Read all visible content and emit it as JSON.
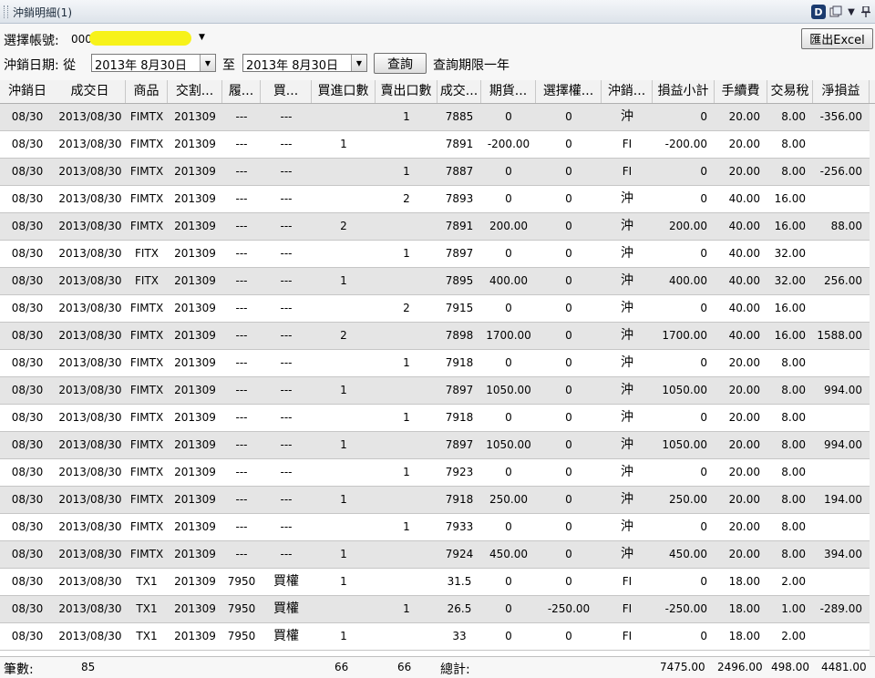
{
  "window": {
    "title": "沖銷明細(1)",
    "d_icon_letter": "D"
  },
  "toolbar": {
    "account_label": "選擇帳號:",
    "account_value": "000",
    "date_label": "沖銷日期: 從",
    "date_from": "2013年  8月30日",
    "to_label": "至",
    "date_to": "2013年  8月30日",
    "query_button": "查詢",
    "query_note": "查詢期限一年",
    "excel_button": "匯出Excel"
  },
  "table": {
    "columns": [
      "沖銷日",
      "成交日",
      "商品",
      "交割...",
      "履...",
      "買...",
      "買進口數",
      "賣出口數",
      "成交...",
      "期貨...",
      "選擇權...",
      "沖銷...",
      "損益小計",
      "手續費",
      "交易稅",
      "淨損益"
    ],
    "rows": [
      [
        "08/30",
        "2013/08/30",
        "FIMTX",
        "201309",
        "---",
        "---",
        "",
        "1",
        "7885",
        "0",
        "0",
        "沖",
        "0",
        "20.00",
        "8.00",
        "-356.00"
      ],
      [
        "08/30",
        "2013/08/30",
        "FIMTX",
        "201309",
        "---",
        "---",
        "1",
        "",
        "7891",
        "-200.00",
        "0",
        "FI",
        "-200.00",
        "20.00",
        "8.00",
        ""
      ],
      [
        "08/30",
        "2013/08/30",
        "FIMTX",
        "201309",
        "---",
        "---",
        "",
        "1",
        "7887",
        "0",
        "0",
        "FI",
        "0",
        "20.00",
        "8.00",
        "-256.00"
      ],
      [
        "08/30",
        "2013/08/30",
        "FIMTX",
        "201309",
        "---",
        "---",
        "",
        "2",
        "7893",
        "0",
        "0",
        "沖",
        "0",
        "40.00",
        "16.00",
        ""
      ],
      [
        "08/30",
        "2013/08/30",
        "FIMTX",
        "201309",
        "---",
        "---",
        "2",
        "",
        "7891",
        "200.00",
        "0",
        "沖",
        "200.00",
        "40.00",
        "16.00",
        "88.00"
      ],
      [
        "08/30",
        "2013/08/30",
        "FITX",
        "201309",
        "---",
        "---",
        "",
        "1",
        "7897",
        "0",
        "0",
        "沖",
        "0",
        "40.00",
        "32.00",
        ""
      ],
      [
        "08/30",
        "2013/08/30",
        "FITX",
        "201309",
        "---",
        "---",
        "1",
        "",
        "7895",
        "400.00",
        "0",
        "沖",
        "400.00",
        "40.00",
        "32.00",
        "256.00"
      ],
      [
        "08/30",
        "2013/08/30",
        "FIMTX",
        "201309",
        "---",
        "---",
        "",
        "2",
        "7915",
        "0",
        "0",
        "沖",
        "0",
        "40.00",
        "16.00",
        ""
      ],
      [
        "08/30",
        "2013/08/30",
        "FIMTX",
        "201309",
        "---",
        "---",
        "2",
        "",
        "7898",
        "1700.00",
        "0",
        "沖",
        "1700.00",
        "40.00",
        "16.00",
        "1588.00"
      ],
      [
        "08/30",
        "2013/08/30",
        "FIMTX",
        "201309",
        "---",
        "---",
        "",
        "1",
        "7918",
        "0",
        "0",
        "沖",
        "0",
        "20.00",
        "8.00",
        ""
      ],
      [
        "08/30",
        "2013/08/30",
        "FIMTX",
        "201309",
        "---",
        "---",
        "1",
        "",
        "7897",
        "1050.00",
        "0",
        "沖",
        "1050.00",
        "20.00",
        "8.00",
        "994.00"
      ],
      [
        "08/30",
        "2013/08/30",
        "FIMTX",
        "201309",
        "---",
        "---",
        "",
        "1",
        "7918",
        "0",
        "0",
        "沖",
        "0",
        "20.00",
        "8.00",
        ""
      ],
      [
        "08/30",
        "2013/08/30",
        "FIMTX",
        "201309",
        "---",
        "---",
        "1",
        "",
        "7897",
        "1050.00",
        "0",
        "沖",
        "1050.00",
        "20.00",
        "8.00",
        "994.00"
      ],
      [
        "08/30",
        "2013/08/30",
        "FIMTX",
        "201309",
        "---",
        "---",
        "",
        "1",
        "7923",
        "0",
        "0",
        "沖",
        "0",
        "20.00",
        "8.00",
        ""
      ],
      [
        "08/30",
        "2013/08/30",
        "FIMTX",
        "201309",
        "---",
        "---",
        "1",
        "",
        "7918",
        "250.00",
        "0",
        "沖",
        "250.00",
        "20.00",
        "8.00",
        "194.00"
      ],
      [
        "08/30",
        "2013/08/30",
        "FIMTX",
        "201309",
        "---",
        "---",
        "",
        "1",
        "7933",
        "0",
        "0",
        "沖",
        "0",
        "20.00",
        "8.00",
        ""
      ],
      [
        "08/30",
        "2013/08/30",
        "FIMTX",
        "201309",
        "---",
        "---",
        "1",
        "",
        "7924",
        "450.00",
        "0",
        "沖",
        "450.00",
        "20.00",
        "8.00",
        "394.00"
      ],
      [
        "08/30",
        "2013/08/30",
        "TX1",
        "201309",
        "7950",
        "買權",
        "1",
        "",
        "31.5",
        "0",
        "0",
        "FI",
        "0",
        "18.00",
        "2.00",
        ""
      ],
      [
        "08/30",
        "2013/08/30",
        "TX1",
        "201309",
        "7950",
        "買權",
        "",
        "1",
        "26.5",
        "0",
        "-250.00",
        "FI",
        "-250.00",
        "18.00",
        "1.00",
        "-289.00"
      ],
      [
        "08/30",
        "2013/08/30",
        "TX1",
        "201309",
        "7950",
        "買權",
        "1",
        "",
        "33",
        "0",
        "0",
        "FI",
        "0",
        "18.00",
        "2.00",
        ""
      ]
    ]
  },
  "footer": {
    "count_label": "筆數:",
    "count": "85",
    "buy_total": "66",
    "sell_total": "66",
    "total_label": "總計:",
    "pl_total": "7475.00",
    "fee_total": "2496.00",
    "tax_total": "498.00",
    "net_total": "4481.00"
  }
}
